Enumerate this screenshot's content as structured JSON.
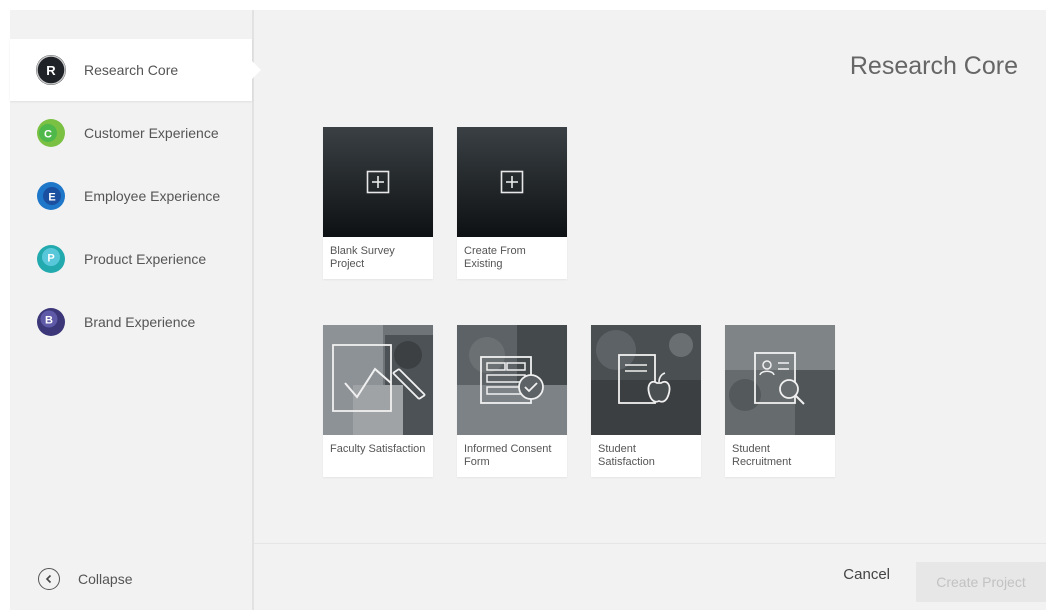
{
  "sidebar": {
    "items": [
      {
        "label": "Research Core",
        "icon": "research-core-icon",
        "letter": "R",
        "color": "#1f2328"
      },
      {
        "label": "Customer Experience",
        "icon": "customer-experience-icon",
        "letter": "C",
        "color": "#7ac143"
      },
      {
        "label": "Employee Experience",
        "icon": "employee-experience-icon",
        "letter": "E",
        "color": "#1f77c9"
      },
      {
        "label": "Product Experience",
        "icon": "product-experience-icon",
        "letter": "P",
        "color": "#22aaae"
      },
      {
        "label": "Brand Experience",
        "icon": "brand-experience-icon",
        "letter": "B",
        "color": "#3b3779"
      }
    ],
    "collapse_label": "Collapse"
  },
  "main": {
    "title": "Research Core",
    "cards": [
      {
        "label": "Blank Survey Project",
        "icon": "plus-square-icon"
      },
      {
        "label": "Create From Existing",
        "icon": "plus-square-icon"
      },
      {
        "label": "Faculty Satisfaction",
        "icon": "checkmark-pen-icon"
      },
      {
        "label": "Informed Consent Form",
        "icon": "form-check-icon"
      },
      {
        "label": "Student Satisfaction",
        "icon": "document-apple-icon"
      },
      {
        "label": "Student Recruitment",
        "icon": "id-card-search-icon"
      }
    ]
  },
  "footer": {
    "cancel_label": "Cancel",
    "create_label": "Create Project"
  }
}
